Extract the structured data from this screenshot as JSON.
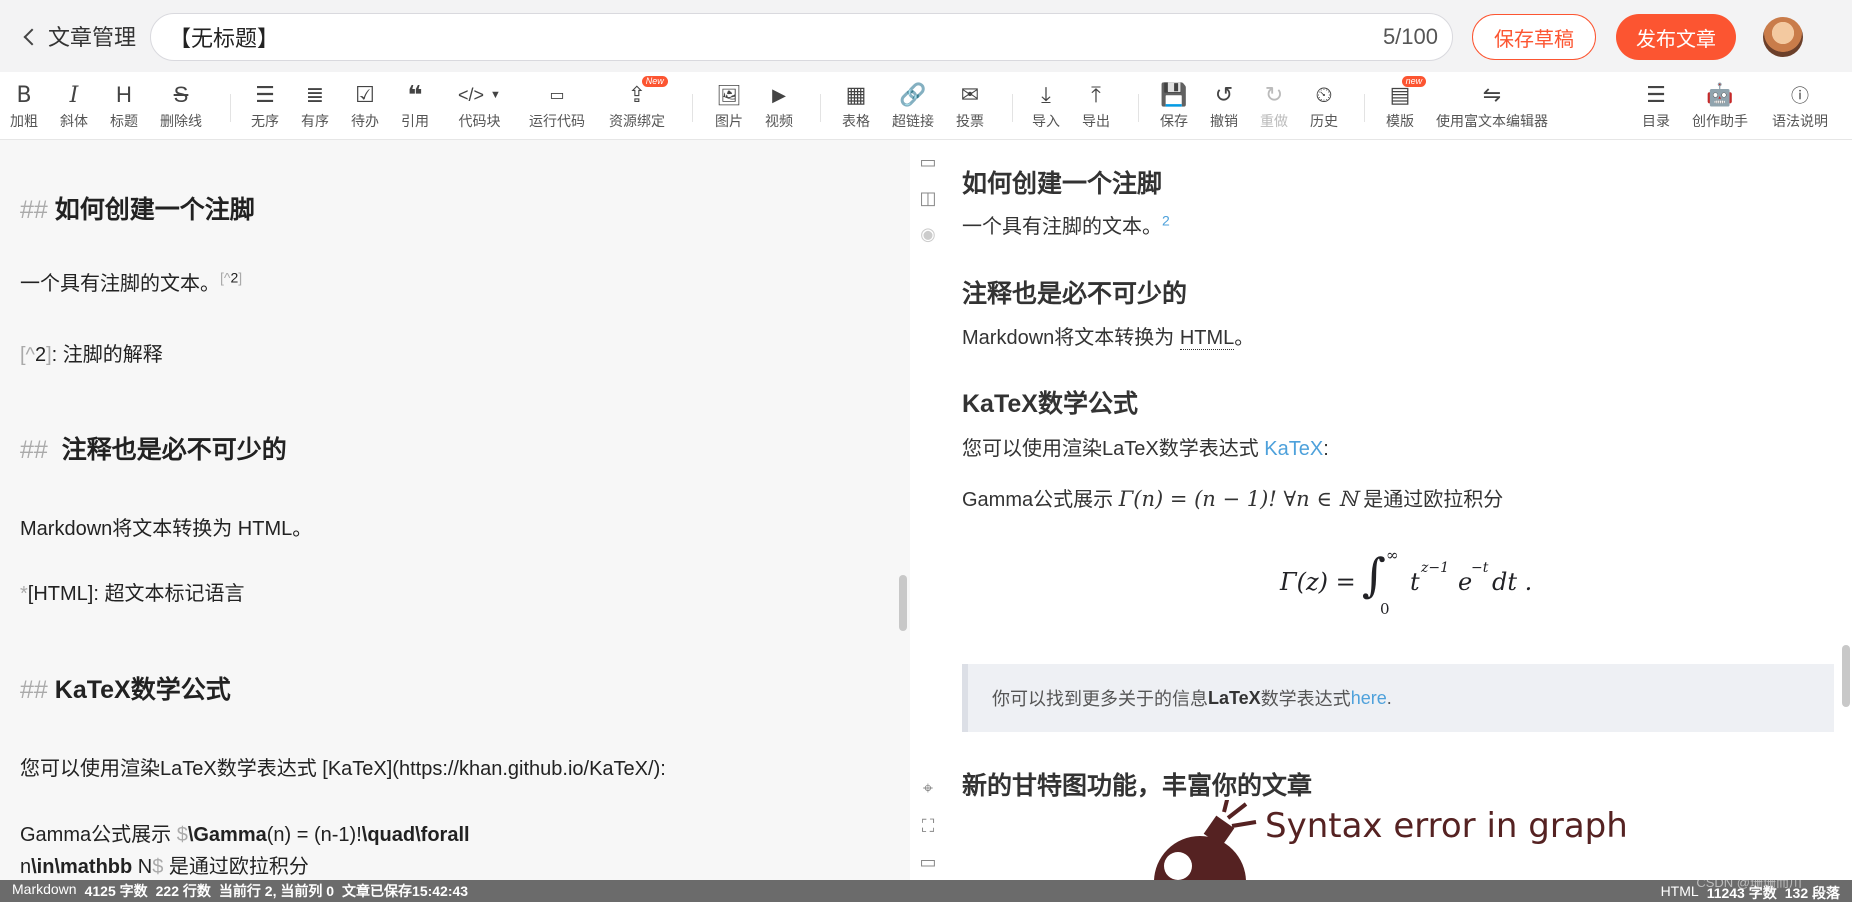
{
  "header": {
    "back_label": "文章管理",
    "title_value": "【无标题】",
    "title_count": "5/100",
    "save_draft": "保存草稿",
    "publish": "发布文章"
  },
  "toolbar": {
    "bold": "加粗",
    "italic": "斜体",
    "heading": "标题",
    "strike": "删除线",
    "ul": "无序",
    "ol": "有序",
    "todo": "待办",
    "quote": "引用",
    "code": "代码块",
    "run": "运行代码",
    "resource": "资源绑定",
    "new_badge": "New",
    "image": "图片",
    "video": "视频",
    "table": "表格",
    "link": "超链接",
    "vote": "投票",
    "import": "导入",
    "export": "导出",
    "save": "保存",
    "undo": "撤销",
    "redo": "重做",
    "history": "历史",
    "template": "模版",
    "template_badge": "new",
    "rich": "使用富文本编辑器",
    "toc": "目录",
    "assistant": "创作助手",
    "syntax": "语法说明"
  },
  "editor": {
    "h1_mark": "##",
    "h1_text": "如何创建一个注脚",
    "p1_text": "一个具有注脚的文本。",
    "p1_fn_open": "[^",
    "p1_fn_num": "2",
    "p1_fn_close": "]",
    "fn_open": "[^",
    "fn_num": "2",
    "fn_close": "]",
    "fn_text": ": 注脚的解释",
    "h2_mark": "##",
    "h2_text": "注释也是必不可少的",
    "p2": "Markdown将文本转换为 HTML。",
    "abbr_star": "*",
    "abbr_text": "[HTML]:   超文本标记语言",
    "h3_mark": "##",
    "h3_text": "KaTeX数学公式",
    "p3": "您可以使用渲染LaTeX数学表达式 [KaTeX](https://khan.github.io/KaTeX/):",
    "p4_a": "Gamma公式展示 ",
    "p4_dollar": "$",
    "p4_b": "\\Gamma",
    "p4_c": "(n) = (n-1)!",
    "p4_d": "\\quad\\forall",
    "p5_a": "n",
    "p5_b": "\\in\\mathbb",
    "p5_c": " N",
    "p5_dollar": "$",
    "p5_d": " 是通过欧拉积分"
  },
  "preview": {
    "h1": "如何创建一个注脚",
    "p1": "一个具有注脚的文本。",
    "p1_sup": "2",
    "h2": "注释也是必不可少的",
    "p2_a": "Markdown将文本转换为 ",
    "p2_abbr": "HTML",
    "p2_b": "。",
    "h3": "KaTeX数学公式",
    "p3_a": "您可以使用渲染LaTeX数学表达式 ",
    "p3_link": "KaTeX",
    "p3_b": ":",
    "p4_a": "Gamma公式展示 ",
    "p4_math": "Γ(n) = (n − 1)!   ∀n ∈ ℕ",
    "p4_b": " 是通过欧拉积分",
    "formula_lhs": "Γ(z) =",
    "formula_sup": "∞",
    "formula_sub": "0",
    "formula_body": "t",
    "formula_exp1": "z−1",
    "formula_e": "e",
    "formula_exp2": "−t",
    "formula_dt": "dt .",
    "quote_a": "你可以找到更多关于的信息 ",
    "quote_b": "LaTeX",
    "quote_c": " 数学表达式",
    "quote_link": "here",
    "quote_d": ".",
    "h4": "新的甘特图功能，丰富你的文章",
    "error_text": "Syntax error in graph"
  },
  "status": {
    "mode_l": "Markdown",
    "words_l": "4125 字数",
    "lines_l": "222 行数",
    "pos_l": "当前行 2, 当前列 0",
    "saved_l": "文章已保存15:42:43",
    "mode_r": "HTML",
    "words_r": "11243 字数",
    "para_r": "132 段落",
    "watermark": "CSDN @珊珊而川"
  },
  "colors": {
    "accent": "#fc5531",
    "link": "#4ea1db",
    "status_bg": "#6b6b6b"
  }
}
